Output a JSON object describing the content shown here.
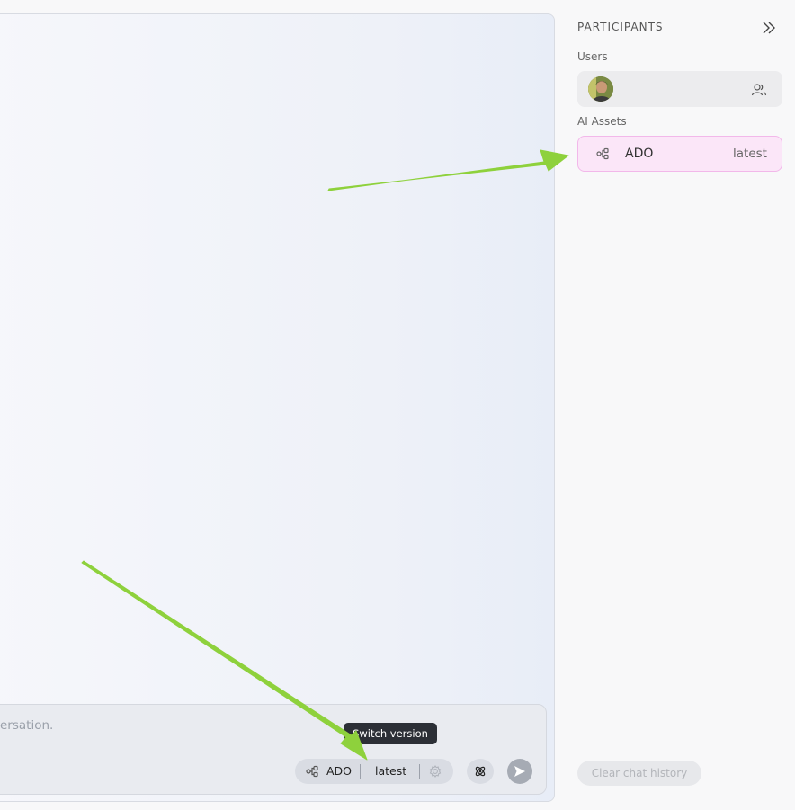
{
  "composer": {
    "placeholder_fragment": "ersation.",
    "asset": {
      "name": "ADO",
      "version": "latest"
    },
    "tooltip": "Switch version"
  },
  "sidebar": {
    "title": "PARTICIPANTS",
    "users_label": "Users",
    "assets_label": "AI Assets",
    "assets": [
      {
        "name": "ADO",
        "version": "latest"
      }
    ],
    "clear_history_label": "Clear chat history"
  },
  "colors": {
    "asset_highlight": "#fbe6f8",
    "asset_border": "#f2b8ea",
    "annotation_arrow": "#8ed13c"
  },
  "icons": {
    "collapse": "double-chevron-right-icon",
    "users": "users-icon",
    "asset": "asset-tree-icon",
    "gear": "gear-icon",
    "atom": "atom-icon",
    "send": "send-icon"
  }
}
